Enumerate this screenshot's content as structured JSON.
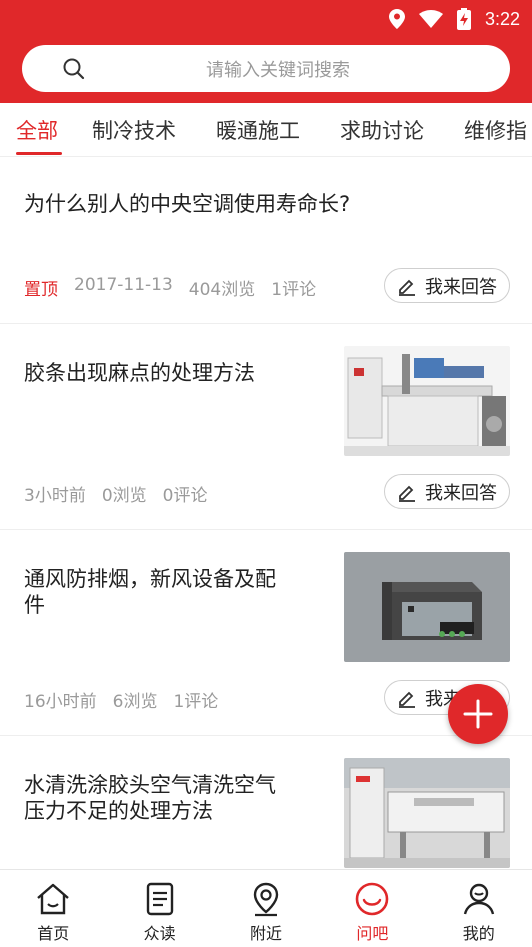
{
  "status": {
    "time": "3:22"
  },
  "search": {
    "placeholder": "请输入关键词搜索"
  },
  "tabs": [
    {
      "label": "全部",
      "active": true
    },
    {
      "label": "制冷技术"
    },
    {
      "label": "暖通施工"
    },
    {
      "label": "求助讨论"
    },
    {
      "label": "维修指"
    }
  ],
  "posts": [
    {
      "title_line1": "为什么别人的中央空调使用寿命长?",
      "pin": "置顶",
      "date": "2017-11-13",
      "views": "404浏览",
      "comments": "1评论",
      "answer_label": "我来回答"
    },
    {
      "title_line1": "胶条出现麻点的处理方法",
      "time": "3小时前",
      "views": "0浏览",
      "comments": "0评论",
      "answer_label": "我来回答",
      "thumb": "machine-photo"
    },
    {
      "title_line1": "通风防排烟，新风设备及配",
      "title_line2": "件",
      "time": "16小时前",
      "views": "6浏览",
      "comments": "1评论",
      "answer_label": "我来回答",
      "thumb": "box-photo"
    },
    {
      "title_line1": "水清洗涂胶头空气清洗空气",
      "title_line2": "压力不足的处理方法",
      "thumb": "machine-photo"
    }
  ],
  "nav": [
    {
      "label": "首页",
      "icon": "home-icon"
    },
    {
      "label": "众读",
      "icon": "document-icon"
    },
    {
      "label": "附近",
      "icon": "location-pin-icon"
    },
    {
      "label": "问吧",
      "icon": "ask-circle-icon",
      "active": true
    },
    {
      "label": "我的",
      "icon": "user-icon"
    }
  ],
  "colors": {
    "accent": "#e0282a",
    "muted": "#9a9a9a"
  }
}
